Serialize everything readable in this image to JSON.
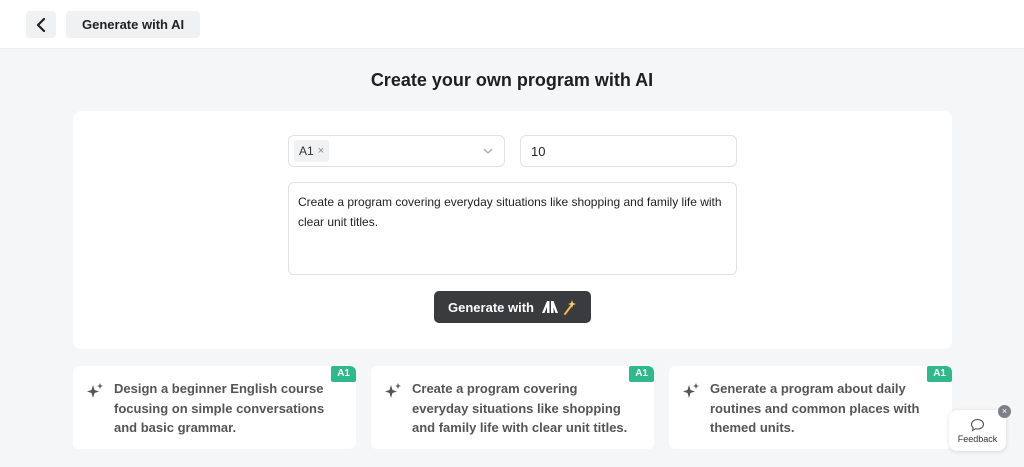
{
  "header": {
    "back_icon": "chevron-left-icon",
    "title": "Generate with AI"
  },
  "main": {
    "heading": "Create your own program with AI",
    "level_select": {
      "selected_tag": "A1",
      "remove_glyph": "×",
      "icon": "chevron-down-icon"
    },
    "count_input": {
      "value": "10"
    },
    "prompt": {
      "value": "Create a program covering everyday situations like shopping and family life with clear unit titles."
    },
    "generate_button": {
      "label": "Generate with",
      "logo": "ai-logo-icon",
      "icon": "magic-wand-icon"
    }
  },
  "suggestions": [
    {
      "badge": "A1",
      "icon": "sparkles-icon",
      "text": "Design a beginner English course focusing on simple conversations and basic grammar."
    },
    {
      "badge": "A1",
      "icon": "sparkles-icon",
      "text": "Create a program covering everyday situations like shopping and family life with clear unit titles."
    },
    {
      "badge": "A1",
      "icon": "sparkles-icon",
      "text": "Generate a program about daily routines and common places with themed units."
    }
  ],
  "feedback": {
    "label": "Feedback",
    "icon": "chat-bubble-icon",
    "close_glyph": "×"
  },
  "colors": {
    "badge": "#2fb889",
    "button": "#3a3b3f",
    "background": "#f5f6f8"
  }
}
